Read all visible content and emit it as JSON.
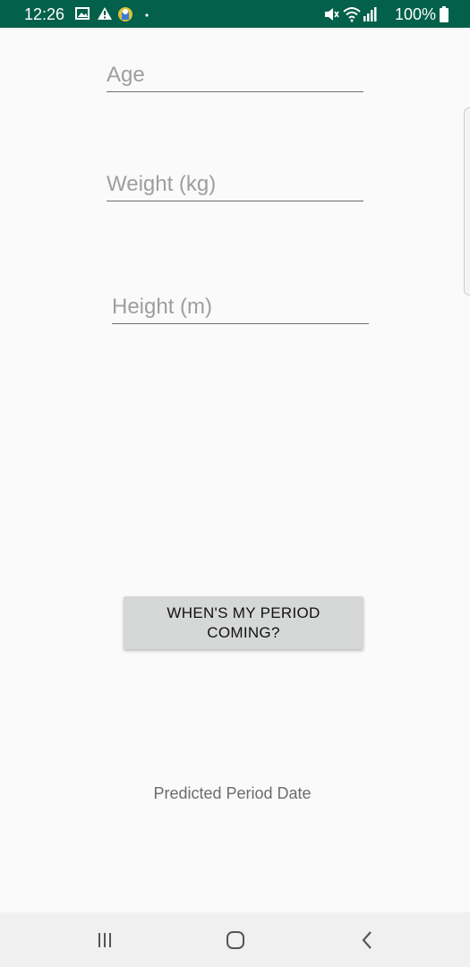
{
  "status_bar": {
    "time": "12:26",
    "battery": "100%",
    "left_icons": [
      "image-icon",
      "warning-icon",
      "app-notification-icon",
      "dot-icon"
    ],
    "right_icons": [
      "mute-icon",
      "wifi-icon",
      "signal-icon",
      "battery-icon"
    ],
    "background_color": "#03604a"
  },
  "form": {
    "age_placeholder": "Age",
    "age_value": "",
    "weight_placeholder": "Weight (kg)",
    "weight_value": "",
    "height_placeholder": "Height (m)",
    "height_value": ""
  },
  "predict_button": {
    "label": "WHEN'S MY PERIOD COMING?"
  },
  "result": {
    "text": "Predicted Period Date"
  },
  "nav_bar": {
    "buttons": [
      "recent-apps-icon",
      "home-icon",
      "back-icon"
    ]
  }
}
